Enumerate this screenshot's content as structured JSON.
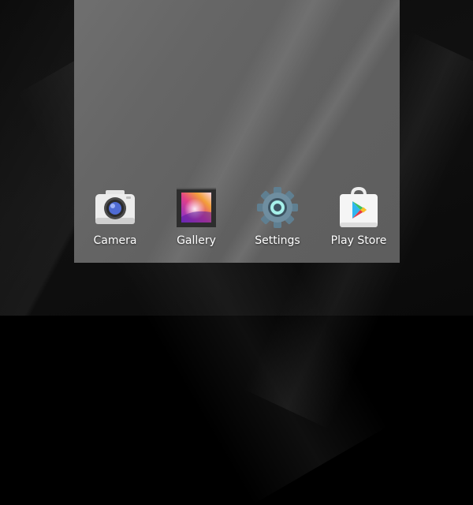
{
  "home_screen": {
    "apps": [
      {
        "label": "Camera",
        "icon": "camera-icon"
      },
      {
        "label": "Gallery",
        "icon": "gallery-icon"
      },
      {
        "label": "Settings",
        "icon": "gear-icon"
      },
      {
        "label": "Play Store",
        "icon": "play-store-icon"
      }
    ]
  },
  "colors": {
    "screen_background": "#666666",
    "desktop_background": "#0c0c0c",
    "label_text": "#ffffff"
  }
}
